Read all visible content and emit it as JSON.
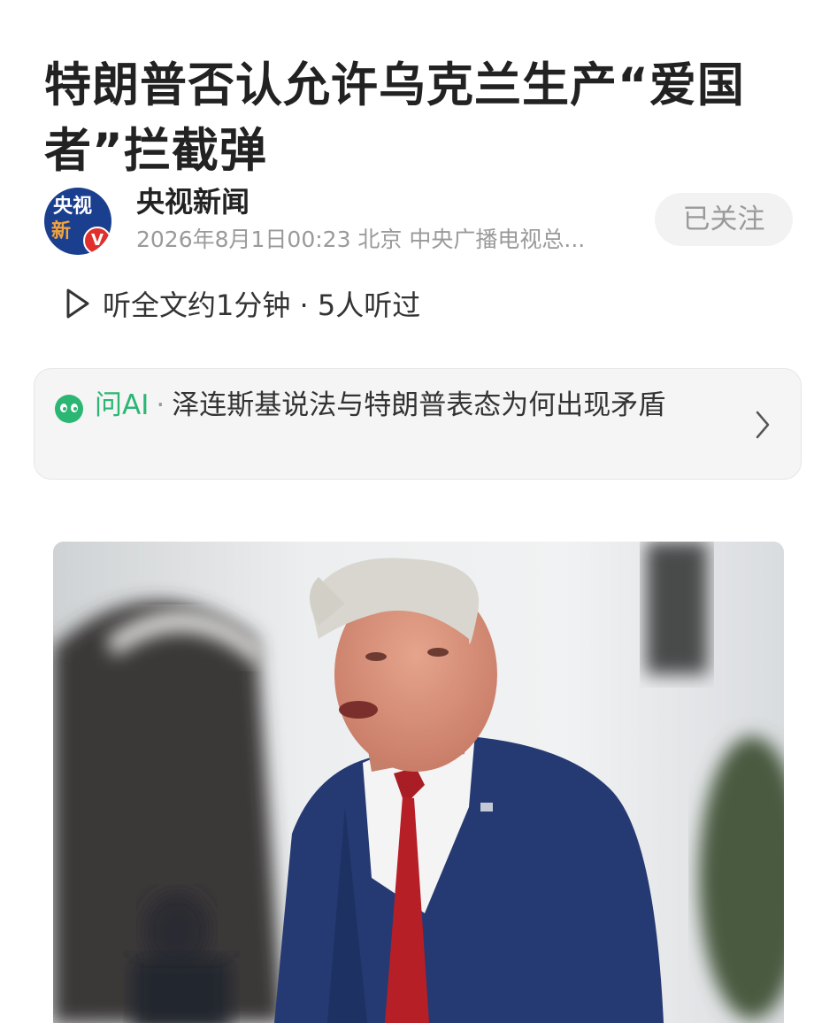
{
  "article": {
    "title": "特朗普否认允许乌克兰生产“爱国者”拦截弹"
  },
  "author": {
    "avatar_top": "央视",
    "avatar_bottom": "新",
    "verified_badge": "V",
    "name": "央视新闻",
    "meta": "2026年8月1日00:23 北京 中央广播电视总...",
    "follow_label": "已关注"
  },
  "listen": {
    "icon": "play-icon",
    "text": "听全文约1分钟 · 5人听过"
  },
  "ask_ai": {
    "icon": "ai-face-icon",
    "label": "问AI",
    "separator": "·",
    "question": "泽连斯基说法与特朗普表态为何出现矛盾",
    "accent_color": "#2bb673"
  },
  "photo": {
    "description_icon": "news-photo"
  }
}
